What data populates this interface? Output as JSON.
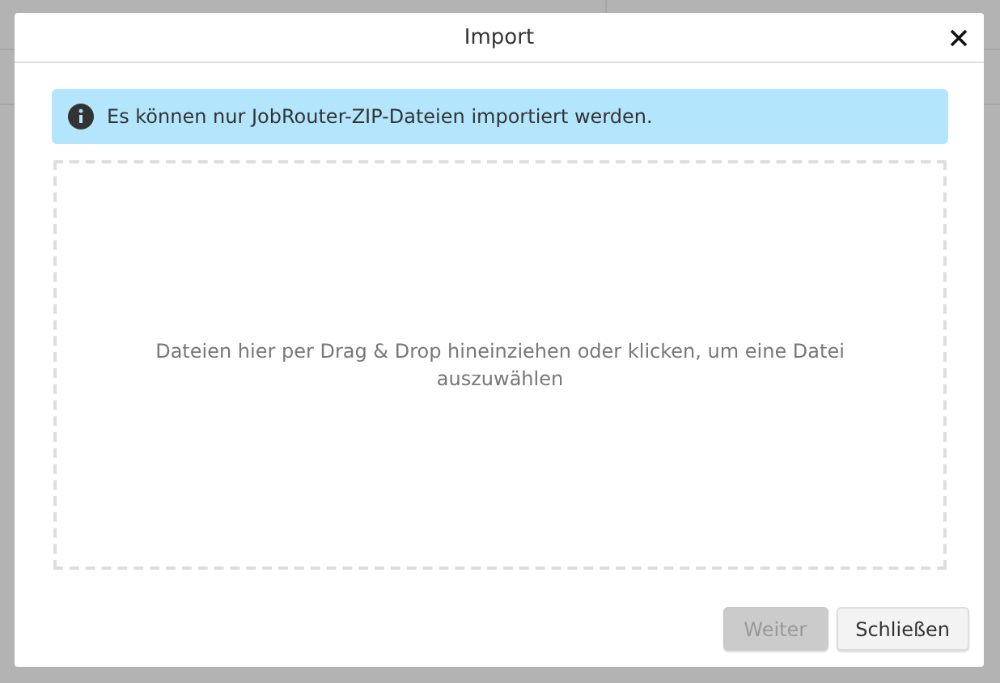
{
  "dialog": {
    "title": "Import"
  },
  "alert": {
    "text": "Es können nur JobRouter-ZIP-Dateien importiert werden."
  },
  "dropzone": {
    "text": "Dateien hier per Drag & Drop hineinziehen oder klicken, um eine Datei auszuwählen"
  },
  "buttons": [
    {
      "label": "Weiter",
      "disabled": true
    },
    {
      "label": "Schließen",
      "disabled": false
    }
  ]
}
